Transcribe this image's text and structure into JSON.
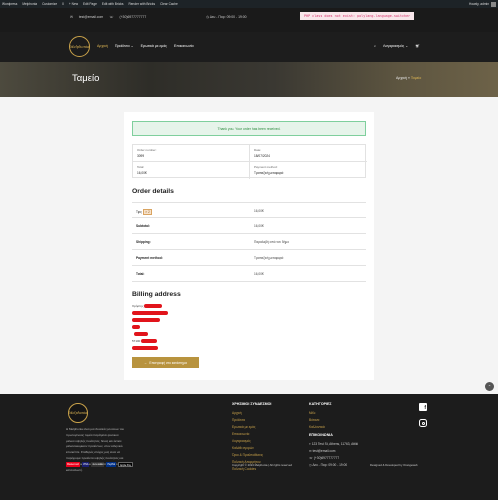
{
  "admin_bar": {
    "items": [
      "Wordpress",
      "Melphonia",
      "Customize",
      "0",
      "+ New",
      "Edit Page",
      "Edit with Bricks",
      "Render with Bricks",
      "Clear Cache"
    ],
    "user": "Howdy, admin"
  },
  "topbar": {
    "email": "test@email.com",
    "phone": "(+30)6977777777",
    "hours": "Δευ - Παρ: 09:00 - 19:00",
    "php_error": "PHP class does not exist: polylang-language-switcher"
  },
  "header": {
    "logo_text": "Melphonia",
    "nav": [
      "Αρχική",
      "Προϊόντα",
      "Ερωτικά με εμάς",
      "Επικοινωνία"
    ],
    "account_label": "Λογαριασμός",
    "search_icon": "search-icon",
    "cart_icon": "cart-icon"
  },
  "banner": {
    "title": "Ταμείο",
    "breadcrumb_home": "Αρχική",
    "breadcrumb_sep": "»",
    "breadcrumb_current": "Ταμείο"
  },
  "order": {
    "notice": "Thank you. Your order has been received.",
    "overview": {
      "order_number_label": "Order number:",
      "order_number": "3099",
      "date_label": "Date:",
      "date": "18/07/2024",
      "total_label": "Total:",
      "total": "16,00€",
      "payment_label": "Payment method:",
      "payment": "Τραπεζική μεταφορά"
    },
    "details_title": "Order details",
    "rows": [
      {
        "key": "Τιρς",
        "qty": "× 2",
        "value": "16,00€"
      },
      {
        "key": "Subtotal:",
        "value": "16,00€"
      },
      {
        "key": "Shipping:",
        "value": "Παραλαβή από τον δήμο"
      },
      {
        "key": "Payment method:",
        "value": "Τραπεζική μεταφορά"
      },
      {
        "key": "Total:",
        "value": "16,00€"
      }
    ],
    "billing_title": "Billing address",
    "billing_lines": [
      "Χρήστης",
      "",
      "",
      "",
      "",
      "",
      "",
      "57100",
      "email"
    ],
    "back_button": "Επιστροφή στο κατάστημα"
  },
  "footer": {
    "logo_text": "Melphonia",
    "about": "Η Melphonia είναι μια δουλειά γνώσεων του πρωτογενούς τομέα παράγεται φυσικού μελιού υψηλής ποιότητας. Ένας και έκτισε μελισσοκομικών προϊόντων, στον ελληνικό επισκέπτε. Σταθερός στόχος μας είναι να παρέχουμε προϊόντα υψηλής ποιότητας και να ικανοποιούμε και τον πιο απαιτητικό καταναλωτή.",
    "links_title": "ΧΡΗΣΙΜΟΙ ΣΥΝΔΕΣΜΟΙ",
    "links": [
      "Αρχική",
      "Προϊόντα",
      "Ερωτικά με εμάς",
      "Επικοινωνία",
      "Λογαριασμός",
      "Καλάθι αγορών",
      "Όροι & Προϋποθέσεις",
      "Πολιτική Απορρήτου",
      "Πολιτική Cookies"
    ],
    "categories_title": "ΚΑΤΗΓΟΡΙΕΣ",
    "categories": [
      "Μέλι",
      "Βότανα",
      "Καλλυντικά"
    ],
    "contact_title": "ΕΠΙΚΟΙΝΩΝΙΑ",
    "contact": [
      "123 Test St, Athens, 11763, Attiki",
      "test@email.com",
      "(+30)6977777777",
      "Δευ - Παρ: 09:00 - 19:00"
    ],
    "payments": [
      "Mastercard",
      "VISA",
      "viva wallet",
      "PayPal",
      "Apple Pay"
    ],
    "copyright": "Copyright © 2024 Melphonia | All rights reserved",
    "developer": "Designed & Developed by Orangeweb",
    "social_icons": [
      "facebook-icon",
      "instagram-icon"
    ],
    "accent": "#c9a24a"
  },
  "colors": {
    "gold": "#c9a24a",
    "dark": "#1c1c1c",
    "success_bg": "#e6f4ea",
    "success_text": "#2b8a3e"
  }
}
